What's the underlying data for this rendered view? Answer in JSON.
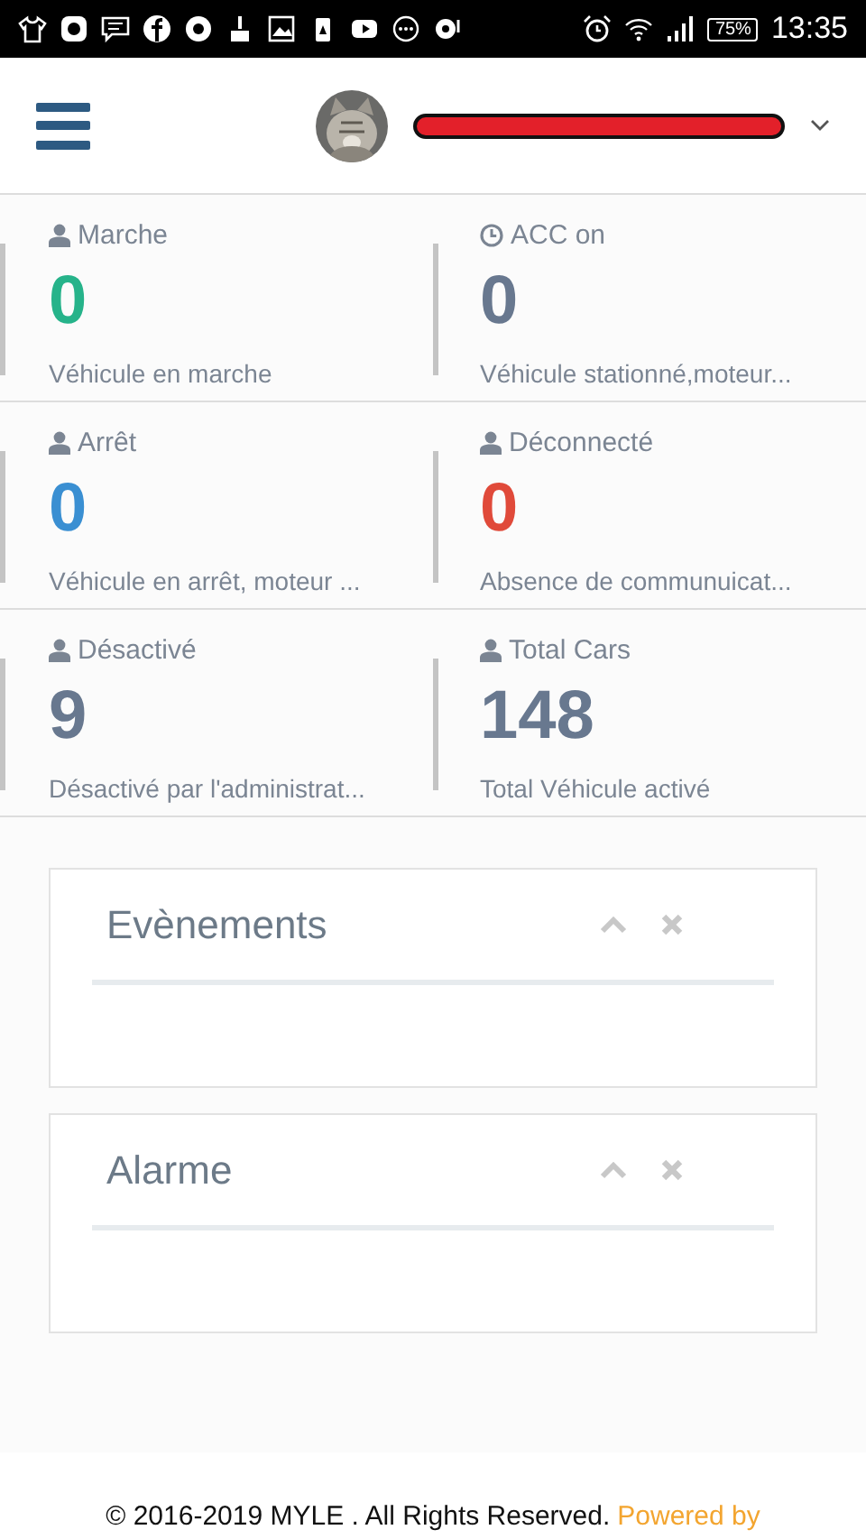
{
  "status_bar": {
    "battery": "75%",
    "time": "13:35"
  },
  "header": {
    "user_name_redacted": true
  },
  "stats": [
    {
      "kind": "user",
      "title": "Marche",
      "value": "0",
      "color": "#26b38a",
      "description": "Véhicule en marche"
    },
    {
      "kind": "clock",
      "title": "ACC on",
      "value": "0",
      "color": "#68788f",
      "description": "Véhicule stationné,moteur..."
    },
    {
      "kind": "user",
      "title": "Arrêt",
      "value": "0",
      "color": "#3a8fd2",
      "description": "Véhicule en arrêt, moteur ..."
    },
    {
      "kind": "user",
      "title": "Déconnecté",
      "value": "0",
      "color": "#e04a3a",
      "description": "Absence de communuicat..."
    },
    {
      "kind": "user",
      "title": "Désactivé",
      "value": "9",
      "color": "#68788f",
      "description": "Désactivé par l'administrat..."
    },
    {
      "kind": "user",
      "title": "Total Cars",
      "value": "148",
      "color": "#68788f",
      "description": "Total Véhicule activé"
    }
  ],
  "panels": [
    {
      "title": "Evènements"
    },
    {
      "title": "Alarme"
    }
  ],
  "footer": {
    "text": "© 2016-2019 MYLE . All Rights Reserved.",
    "link": "Powered by"
  }
}
